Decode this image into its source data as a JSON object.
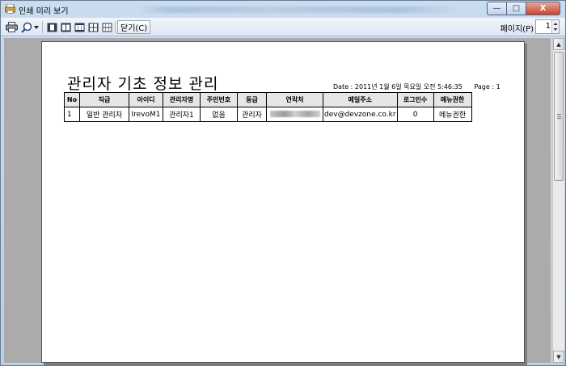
{
  "window": {
    "title": "인쇄 미리 보기",
    "controls": {
      "minimize": "—",
      "maximize": "□",
      "close": "X"
    }
  },
  "toolbar": {
    "icons": [
      "print-icon",
      "zoom-icon",
      "chevron-down-icon",
      "one-page-icon",
      "two-pages-icon",
      "three-pages-icon",
      "four-pages-icon",
      "six-pages-icon"
    ],
    "close_label": "닫기(C)",
    "page_label": "페이지(P)",
    "page_value": "1"
  },
  "report": {
    "title": "관리자 기초 정보 관리",
    "date_label": "Date : 2011년 1월 6일 목요일 오전 5:46:35",
    "page_label": "Page : 1",
    "columns": [
      "No",
      "직급",
      "아이디",
      "관리자명",
      "주민번호",
      "등급",
      "연락처",
      "메일주소",
      "로그인수",
      "메뉴권한"
    ],
    "rows": [
      {
        "no": "1",
        "rank": "일반 관리자",
        "id": "IrevoM1",
        "name": "관리자1",
        "ssn": "없음",
        "grade": "관리자",
        "phone": "",
        "email": "dev@devzone.co.kr",
        "logins": "0",
        "menu_auth": "메뉴권한"
      }
    ]
  },
  "colors": {
    "toolbar": "#e6edf6",
    "preview_bg": "#ababab",
    "header_cell": "#e6e6e6",
    "close_button": "#c8442f"
  }
}
